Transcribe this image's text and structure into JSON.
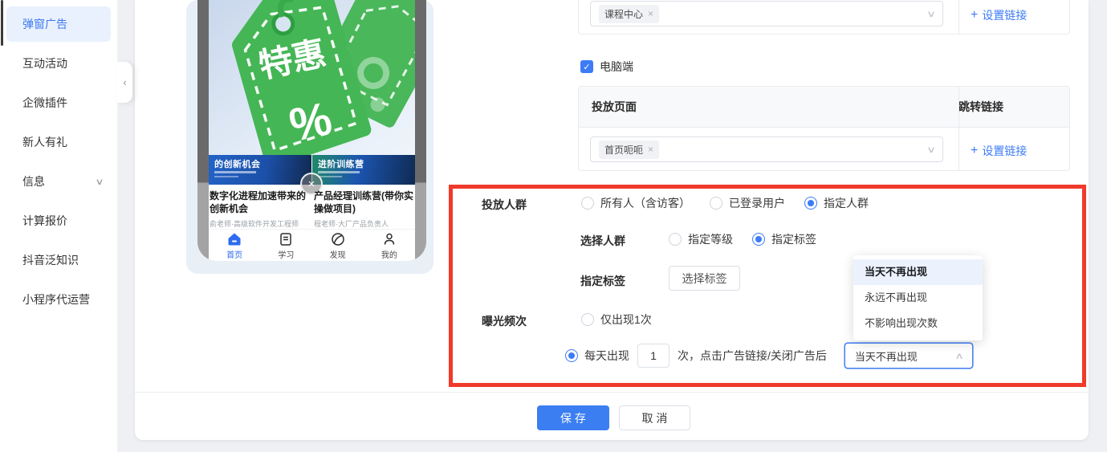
{
  "icons": {
    "plus": "+",
    "chevron_down": "∨",
    "chevron_up": "∧",
    "collapse": "‹",
    "check": "✓",
    "close": "×"
  },
  "sidebar": {
    "items": [
      {
        "label": "弹窗广告"
      },
      {
        "label": "互动活动"
      },
      {
        "label": "企微插件"
      },
      {
        "label": "新人有礼"
      },
      {
        "label": "信息"
      },
      {
        "label": "计算报价"
      },
      {
        "label": "抖音泛知识"
      },
      {
        "label": "小程序代运营"
      }
    ]
  },
  "preview": {
    "ad_badge": "特惠",
    "ad_percent": "%",
    "courses": [
      {
        "banner": "的创新机会",
        "title": "数字化进程加速带来的创新机会",
        "instructor": "俞老师·高级软件开发工程师"
      },
      {
        "banner": "进阶训练营",
        "title": "产品经理训练营(带你实操做项目)",
        "instructor": "程老师·大厂产品负责人"
      }
    ],
    "tabs": [
      {
        "label": "首页"
      },
      {
        "label": "学习"
      },
      {
        "label": "发现"
      },
      {
        "label": "我的"
      }
    ]
  },
  "form": {
    "mobile_section": {
      "selected_tag": "课程中心",
      "set_link": "设置链接"
    },
    "pc_checkbox_label": "电脑端",
    "table": {
      "col_page": "投放页面",
      "col_link": "跳转链接",
      "selected_tag": "首页呃呃",
      "set_link": "设置链接"
    },
    "audience": {
      "label": "投放人群",
      "options": [
        {
          "label": "所有人（含访客）"
        },
        {
          "label": "已登录用户"
        },
        {
          "label": "指定人群"
        }
      ]
    },
    "group": {
      "label": "选择人群",
      "options": [
        {
          "label": "指定等级"
        },
        {
          "label": "指定标签"
        }
      ]
    },
    "tag_row": {
      "label": "指定标签",
      "button": "选择标签"
    },
    "frequency": {
      "label": "曝光频次",
      "option_once": "仅出现1次",
      "daily_prefix": "每天出现",
      "times_value": "1",
      "daily_suffix": "次，点击广告链接/关闭广告后",
      "select_value": "当天不再出现"
    },
    "dropdown": {
      "options": [
        {
          "label": "当天不再出现"
        },
        {
          "label": "永远不再出现"
        },
        {
          "label": "不影响出现次数"
        }
      ]
    }
  },
  "footer": {
    "save": "保 存",
    "cancel": "取 消"
  }
}
